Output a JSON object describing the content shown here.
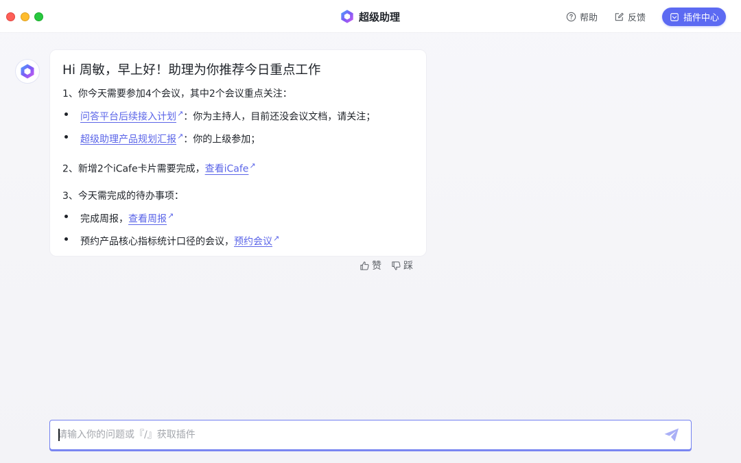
{
  "window": {
    "title": "超级助理",
    "traffic_lights": [
      "close",
      "minimize",
      "maximize"
    ]
  },
  "header": {
    "help_label": "帮助",
    "feedback_label": "反馈",
    "plugin_center_label": "插件中心"
  },
  "colors": {
    "accent": "#5c6af2",
    "link": "#5a64e8",
    "background": "#f5f5f8"
  },
  "message": {
    "greeting": "Hi 周敏，早上好！助理为你推荐今日重点工作",
    "section1": {
      "title": "1、你今天需要参加4个会议，其中2个会议重点关注：",
      "items": [
        {
          "link": "问答平台后续接入计划",
          "text": "：你为主持人，目前还没会议文档，请关注；"
        },
        {
          "link": "超级助理产品规划汇报",
          "text": "：你的上级参加；"
        }
      ]
    },
    "section2": {
      "text": "2、新增2个iCafe卡片需要完成，",
      "link": "查看iCafe"
    },
    "section3": {
      "title": "3、今天需完成的待办事项：",
      "items": [
        {
          "text": "完成周报，",
          "link": "查看周报"
        },
        {
          "text": "预约产品核心指标统计口径的会议，",
          "link": "预约会议"
        }
      ]
    },
    "like_label": "赞",
    "dislike_label": "踩"
  },
  "input": {
    "placeholder": "请输入你的问题或『/』获取插件",
    "value": ""
  },
  "icons": {
    "ext_link": "↗"
  }
}
